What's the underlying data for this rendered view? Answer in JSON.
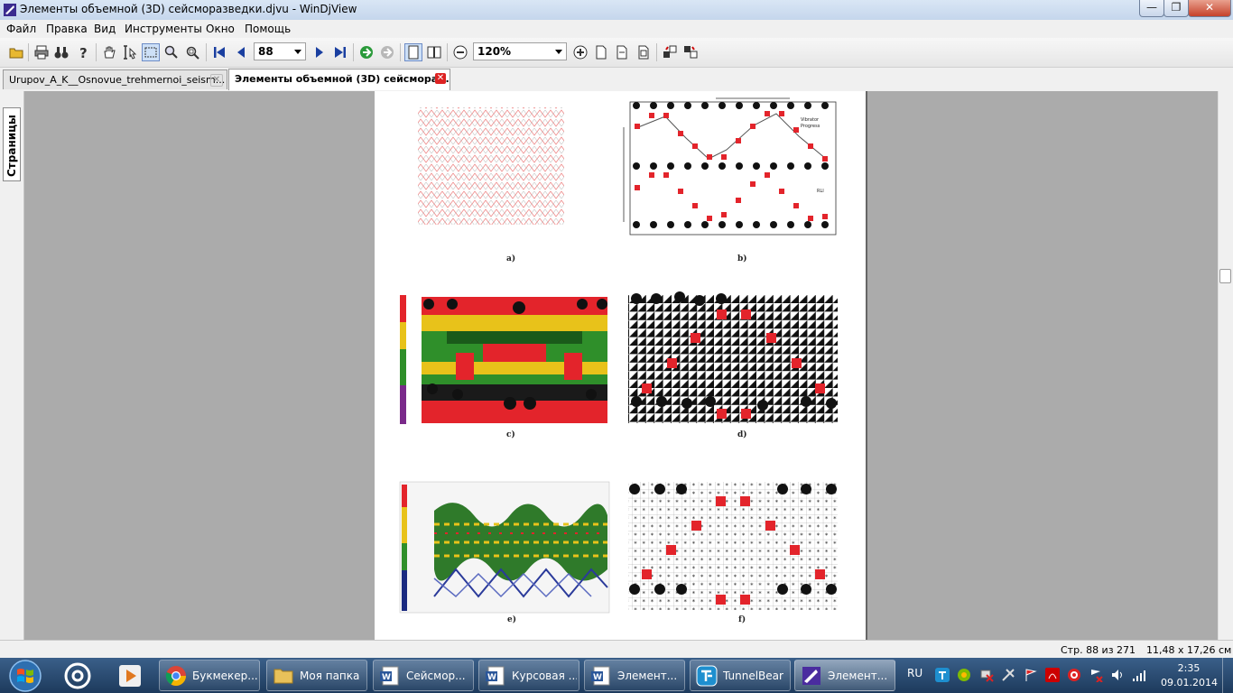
{
  "window": {
    "title": "Элементы объемной (3D) сейсморазведки.djvu - WinDjView",
    "minimize": "—",
    "maximize": "❐",
    "close": "✕"
  },
  "menu": [
    "Файл",
    "Правка",
    "Вид",
    "Инструменты",
    "Окно",
    "Помощь"
  ],
  "toolbar": {
    "page_number": "88",
    "zoom": "120%"
  },
  "tabs": [
    {
      "label": "Urupov_A_K__Osnovue_trehmernoi_seism...",
      "active": false
    },
    {
      "label": "Элементы объемной (3D) сейсмора...",
      "active": true
    }
  ],
  "sidepanel": {
    "pages_tab": "Страницы"
  },
  "document": {
    "captions": [
      "a)",
      "b)",
      "c)",
      "d)",
      "e)",
      "f)"
    ],
    "figure_b_labels": {
      "vibrator": "Vibrator",
      "progress": "Progress",
      "rli": "RLI"
    }
  },
  "status": {
    "page_info": "Стр. 88 из 271",
    "page_size": "11,48 x 17,26 см"
  },
  "taskbar": {
    "tasks": [
      {
        "label": "Букмекер...",
        "icon": "chrome-icon",
        "active": false
      },
      {
        "label": "Моя папка",
        "icon": "folder-icon",
        "active": false
      },
      {
        "label": "Сейсмор...",
        "icon": "word-icon",
        "active": false
      },
      {
        "label": "Курсовая ...",
        "icon": "word-icon",
        "active": false
      },
      {
        "label": "Элемент...",
        "icon": "word-icon",
        "active": false
      },
      {
        "label": "TunnelBear",
        "icon": "tunnelbear-icon",
        "active": false
      },
      {
        "label": "Элемент...",
        "icon": "windjview-icon",
        "active": true
      }
    ],
    "language": "RU",
    "time": "2:35",
    "date": "09.01.2014"
  },
  "colors": {
    "red": "#e3242b",
    "yellow": "#e8c21a",
    "green": "#2f8f2a",
    "dark": "#1a1a1a"
  }
}
